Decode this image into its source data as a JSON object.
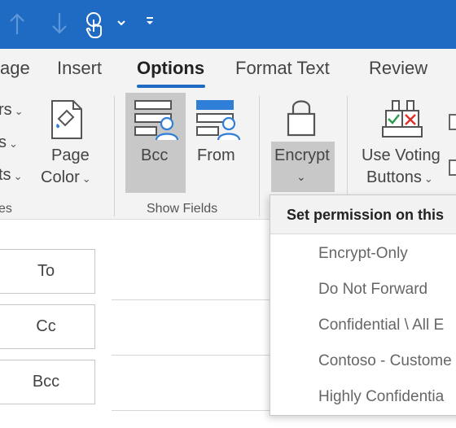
{
  "ribbon_tabs": [
    {
      "label": "age"
    },
    {
      "label": "Insert"
    },
    {
      "label": "Options"
    },
    {
      "label": "Format Text"
    },
    {
      "label": "Review"
    }
  ],
  "colors": {
    "titlebar": "#1f6bc4",
    "accent": "#1f6bc4",
    "ribbon_bg": "#f3f3f3",
    "pressed_bg": "#c8c8c8"
  },
  "ribbon": {
    "left_partial": {
      "row1": "rs",
      "row2": "s",
      "row3": "ts",
      "group_label": "es"
    },
    "page_color": {
      "line1": "Page",
      "line2": "Color"
    },
    "show_fields": {
      "bcc": "Bcc",
      "from": "From",
      "group_label": "Show Fields"
    },
    "encrypt": {
      "label": "Encrypt"
    },
    "voting": {
      "line1": "Use Voting",
      "line2": "Buttons"
    }
  },
  "compose": {
    "to": "To",
    "cc": "Cc",
    "bcc": "Bcc"
  },
  "encrypt_menu": {
    "header": "Set permission on this",
    "items": [
      {
        "label": "Encrypt-Only"
      },
      {
        "label": "Do Not Forward"
      },
      {
        "label": "Confidential \\ All E"
      },
      {
        "label": "Contoso - Custome"
      },
      {
        "label": "Highly Confidentia"
      }
    ]
  }
}
